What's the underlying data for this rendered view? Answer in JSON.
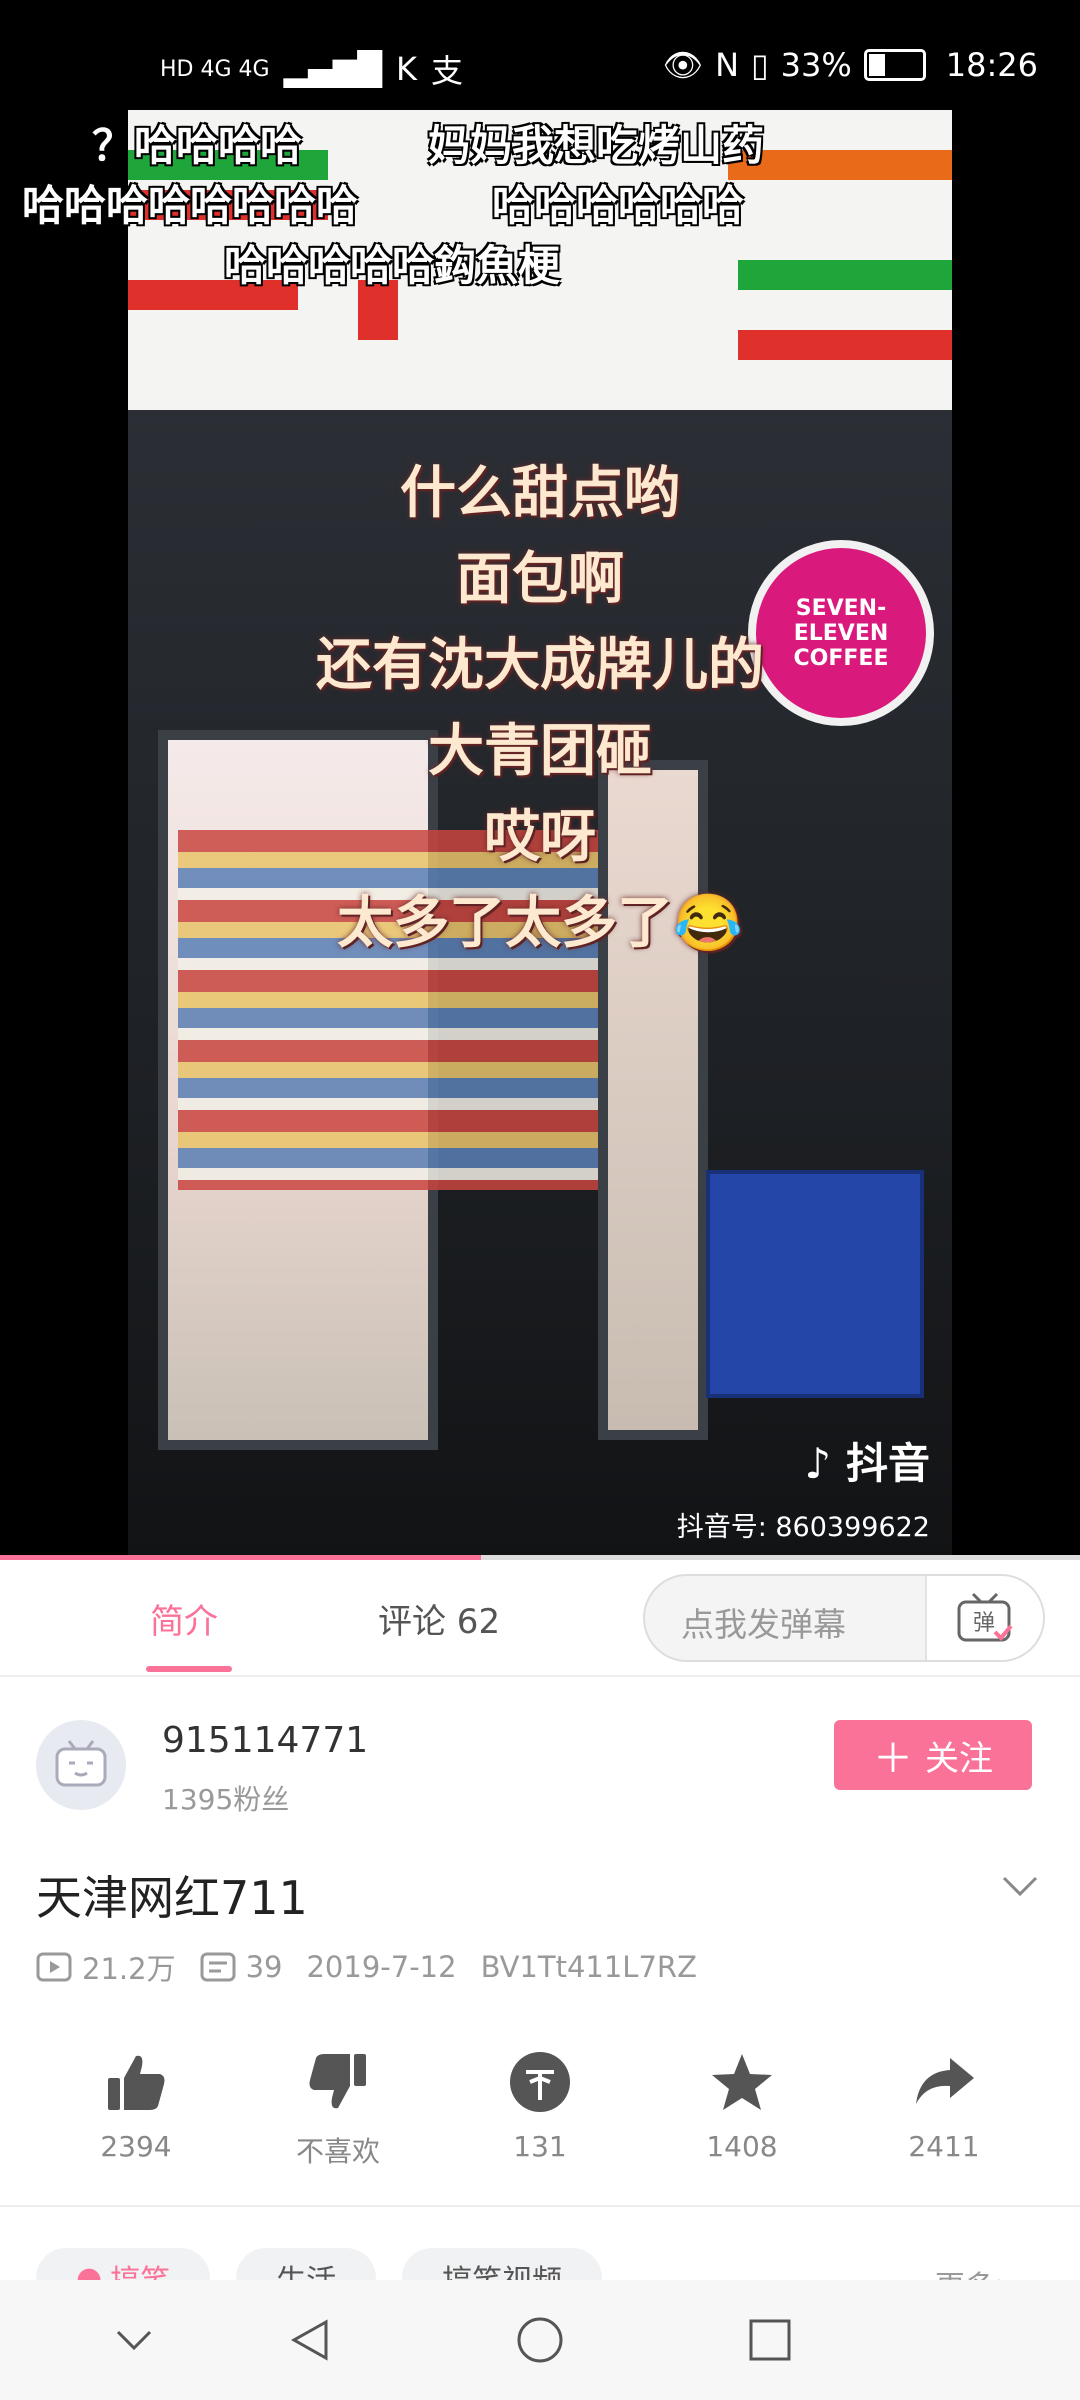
{
  "status_bar": {
    "network": "HD 4G 4G",
    "percent": "33%",
    "time": "18:26"
  },
  "danmaku": [
    "？哈哈哈哈",
    "妈妈我想吃烤山药",
    "哈哈哈哈哈哈哈哈",
    "哈哈哈哈哈哈",
    "哈哈哈哈哈鈎魚梗"
  ],
  "video_lyrics": [
    "什么甜点哟",
    "面包啊",
    "还有沈大成牌儿的",
    "大青团砸",
    "哎呀",
    "太多了太多了😂"
  ],
  "video_watermark": {
    "app": "抖音",
    "id_text": "抖音号: 860399622"
  },
  "store_badge": "SEVEN-ELEVEN COFFEE",
  "progress": 0.445,
  "tabs": {
    "intro": "简介",
    "comments": "评论 62",
    "danmaku_placeholder": "点我发弹幕",
    "danmaku_btn": "弹"
  },
  "uploader": {
    "name": "915114771",
    "fans": "1395粉丝",
    "follow_label": "关注"
  },
  "video": {
    "title": "天津网红711",
    "views": "21.2万",
    "danmaku_count": "39",
    "date": "2019-7-12",
    "bvid": "BV1Tt411L7RZ"
  },
  "actions": [
    {
      "icon": "thumbs-up-icon",
      "label": "2394"
    },
    {
      "icon": "thumbs-down-icon",
      "label": "不喜欢"
    },
    {
      "icon": "coin-icon",
      "label": "131"
    },
    {
      "icon": "star-icon",
      "label": "1408"
    },
    {
      "icon": "share-icon",
      "label": "2411"
    }
  ],
  "tags": [
    "搞笑",
    "生活",
    "搞笑视频"
  ],
  "more_tags": "更多>",
  "colors": {
    "accent": "#fb7299"
  }
}
